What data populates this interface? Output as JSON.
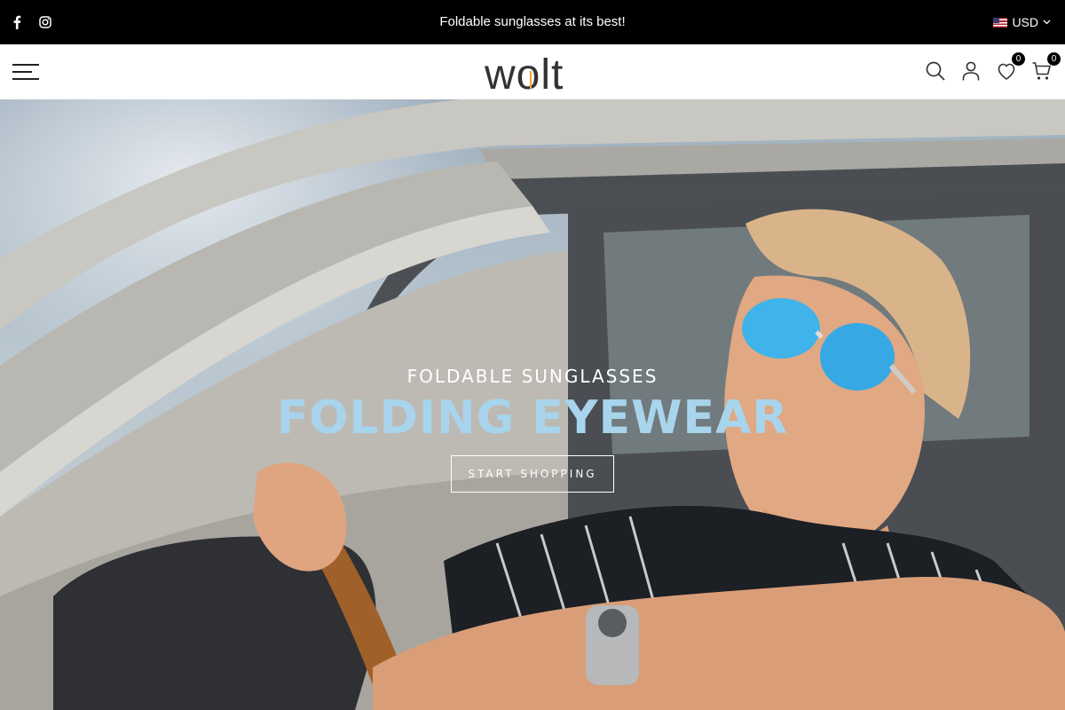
{
  "topbar": {
    "announcement": "Foldable sunglasses at its best!",
    "currency": "USD",
    "social": [
      "facebook-icon",
      "instagram-icon"
    ]
  },
  "header": {
    "logo_text": "wolt",
    "wishlist_count": "0",
    "cart_count": "0",
    "icons": [
      "menu-icon",
      "search-icon",
      "account-icon",
      "heart-icon",
      "cart-icon"
    ]
  },
  "hero": {
    "subtitle": "FOLDABLE SUNGLASSES",
    "title": "FOLDING EYEWEAR",
    "button_label": "START SHOPPING"
  },
  "colors": {
    "topbar_bg": "#000000",
    "hero_title": "#a8d4ec",
    "accent": "#000000"
  }
}
